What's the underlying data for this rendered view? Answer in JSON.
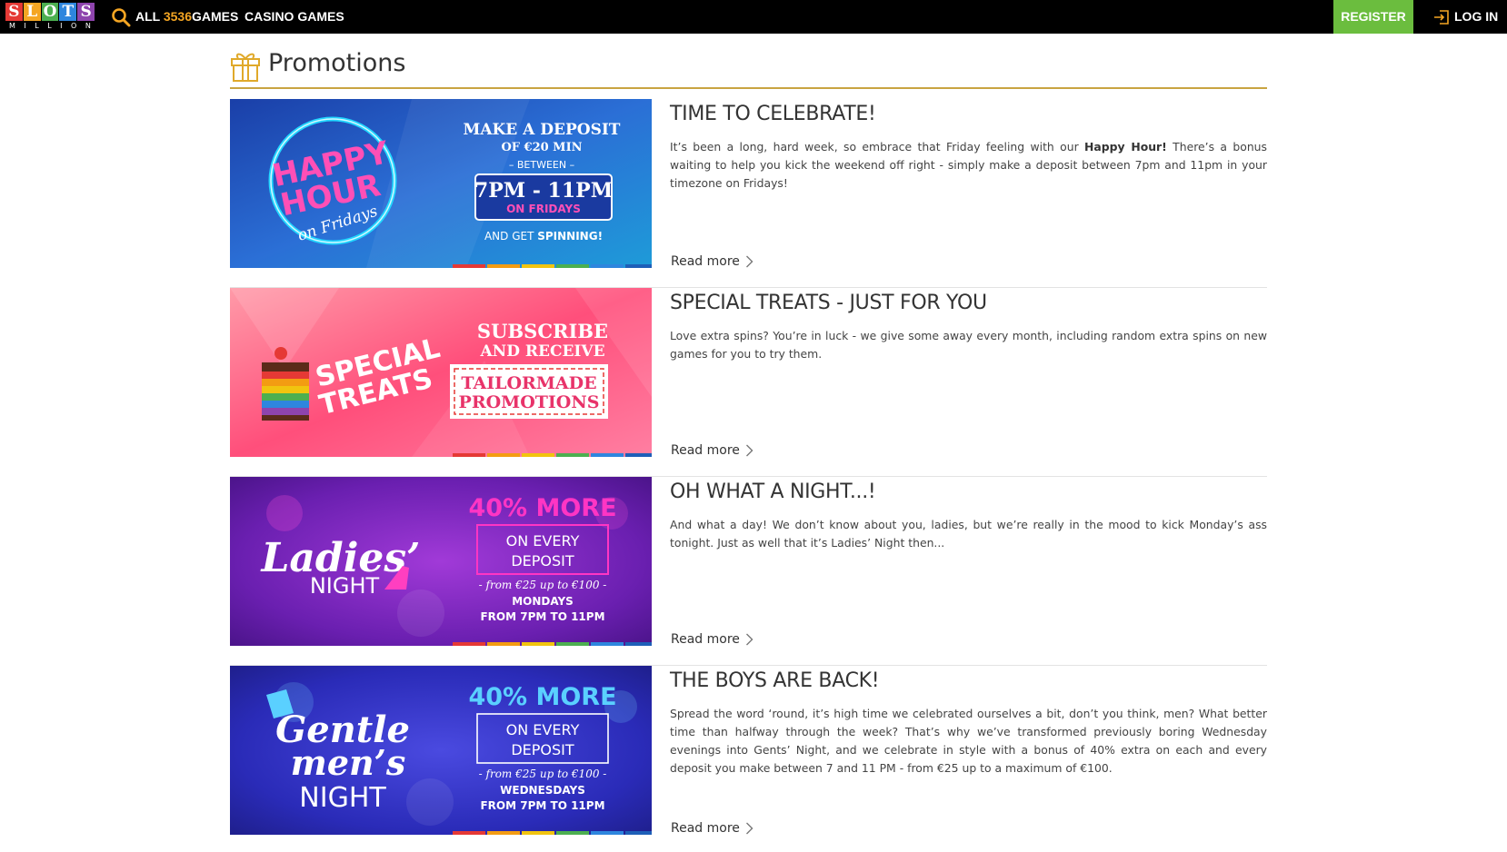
{
  "header": {
    "logo_letters": [
      "S",
      "L",
      "O",
      "T",
      "S"
    ],
    "logo_sub": "MILLION",
    "nav_all_prefix": "ALL",
    "nav_all_count": "3536",
    "nav_all_suffix": "GAMES",
    "nav_casino": "CASINO GAMES",
    "register_label": "REGISTER",
    "login_label": "LOG IN",
    "colors": {
      "bar": "#000000",
      "register": "#6bbd3e",
      "count": "#f5a623"
    }
  },
  "page": {
    "title": "Promotions",
    "accent": "#c9a441"
  },
  "promotions": [
    {
      "title": "TIME TO CELEBRATE!",
      "text_before": "It’s been a long, hard week, so embrace that Friday feeling with our ",
      "text_bold": "Happy Hour!",
      "text_after": " There’s a bonus waiting to help you kick the weekend off right - simply make a deposit between 7pm and 11pm in your timezone on Fridays!",
      "read_more": "Read more",
      "banner": {
        "line1": "HAPPY",
        "line2": "HOUR",
        "line3": "on Fridays",
        "offer1": "MAKE A DEPOSIT",
        "offer2": "OF €20 MIN",
        "offer3": "– BETWEEN –",
        "offer4": "7PM - 11PM",
        "offer5": "ON FRIDAYS",
        "offer6a": "AND GET ",
        "offer6b": "SPINNING!"
      }
    },
    {
      "title": "SPECIAL TREATS - JUST FOR YOU",
      "text_before": "Love extra spins? You’re in luck - we give some away every month, including random extra spins on new games for you to try them.",
      "text_bold": "",
      "text_after": "",
      "read_more": "Read more",
      "banner": {
        "line1": "SPECIAL",
        "line2": "TREATS",
        "offer1": "SUBSCRIBE",
        "offer2": "AND RECEIVE",
        "offer3": "TAILORMADE",
        "offer4": "PROMOTIONS"
      }
    },
    {
      "title": "OH WHAT A NIGHT...!",
      "text_before": "And what a day! We don’t know about you, ladies, but we’re really in the mood to kick Monday’s ass tonight. Just as well that it’s Ladies’ Night then...",
      "text_bold": "",
      "text_after": "",
      "read_more": "Read more",
      "banner": {
        "line1": "Ladies’",
        "line2": "NIGHT",
        "offer1": "40% MORE",
        "offer2": "ON EVERY",
        "offer3": "DEPOSIT",
        "offer4": "- from €25 up to €100 -",
        "offer5": "MONDAYS",
        "offer6": "FROM 7PM TO 11PM"
      }
    },
    {
      "title": "THE BOYS ARE BACK!",
      "text_before": "Spread the word ‘round,  it’s high time we celebrated ourselves a bit, don’t you think, men? What better time than halfway through the week? That’s why we’ve transformed previously boring Wednesday evenings into Gents’ Night, and we celebrate in style with a bonus of 40% extra on each and every deposit you make between 7 and 11 PM - from €25 up to a maximum of €100.",
      "text_bold": "",
      "text_after": "",
      "read_more": "Read more",
      "banner": {
        "line1": "Gentle",
        "line2": "men’s",
        "line3": "NIGHT",
        "offer1": "40% MORE",
        "offer2": "ON EVERY",
        "offer3": "DEPOSIT",
        "offer4": "- from €25 up to €100 -",
        "offer5": "WEDNESDAYS",
        "offer6": "FROM 7PM TO 11PM"
      }
    }
  ],
  "stripe_colors": [
    "#e53935",
    "#f39c12",
    "#f1c40f",
    "#4caf50",
    "#2e86de",
    "#1e5fb8",
    "#8e44ad"
  ]
}
